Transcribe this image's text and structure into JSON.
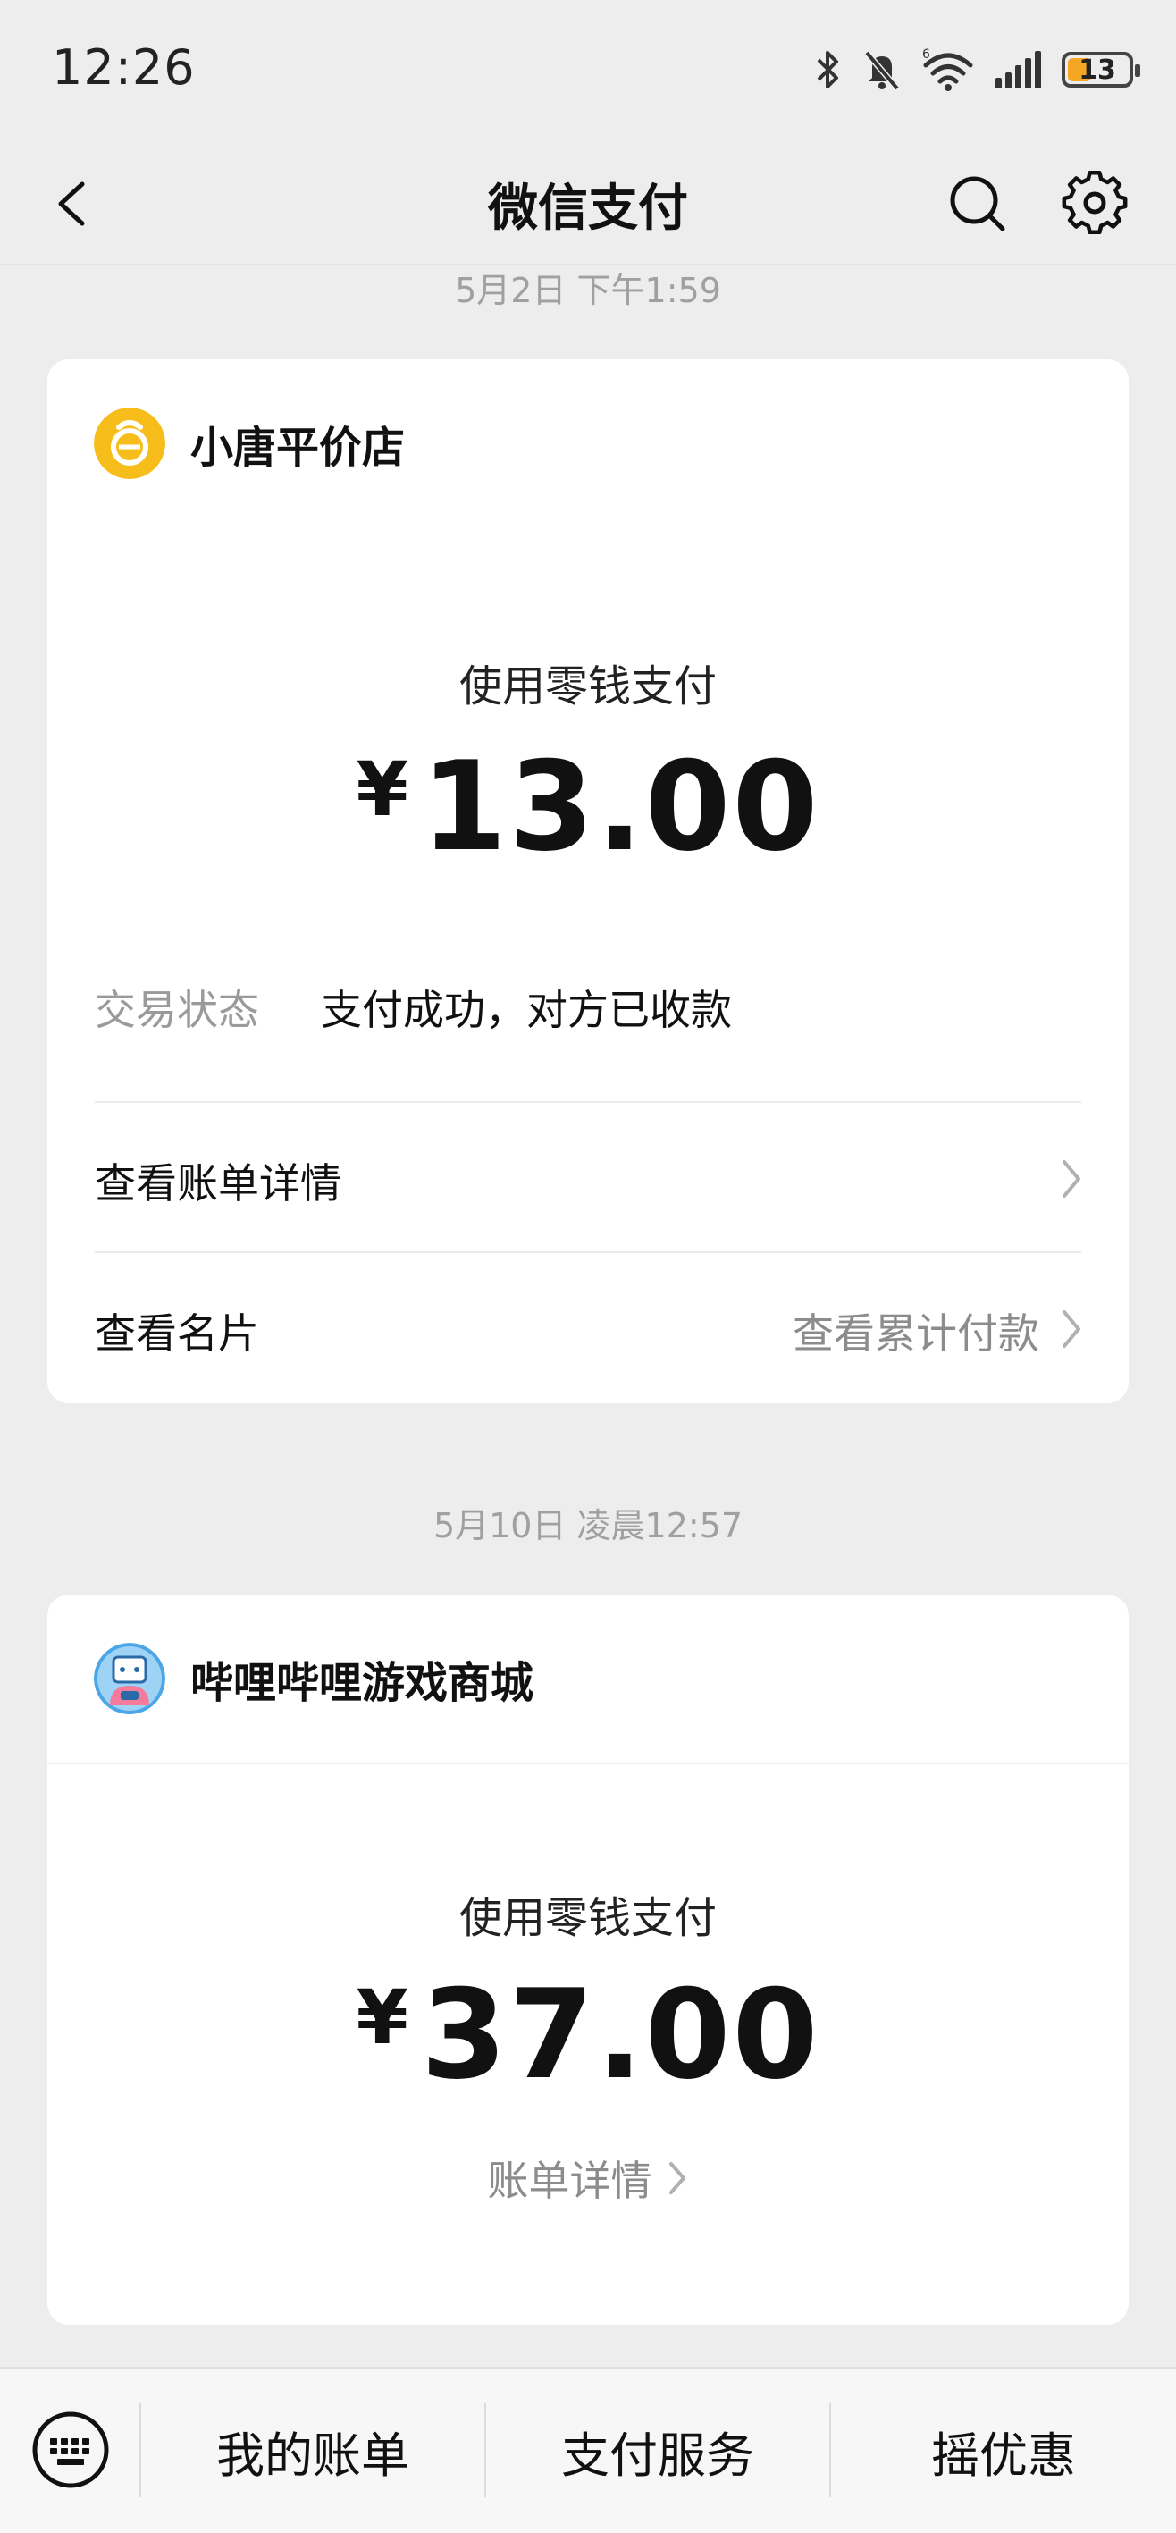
{
  "status_bar": {
    "time": "12:26",
    "battery": "13",
    "network_badge": "6"
  },
  "nav": {
    "title": "微信支付"
  },
  "transactions": [
    {
      "date": "5月2日 下午1:59",
      "merchant": "小唐平价店",
      "pay_method": "使用零钱支付",
      "currency": "¥",
      "amount": "13.00",
      "status_label": "交易状态",
      "status_value": "支付成功，对方已收款",
      "bill_detail": "查看账单详情",
      "card_label": "查看名片",
      "cumulative": "查看累计付款"
    },
    {
      "date": "5月10日 凌晨12:57",
      "merchant": "哔哩哔哩游戏商城",
      "pay_method": "使用零钱支付",
      "currency": "¥",
      "amount": "37.00",
      "bill_detail": "账单详情"
    }
  ],
  "tabbar": {
    "items": [
      "我的账单",
      "支付服务",
      "摇优惠"
    ]
  },
  "colors": {
    "background": "#ededed",
    "card": "#ffffff",
    "merchant_logo_yellow": "#f7be1b",
    "battery_fill": "#f5a623",
    "muted_text": "#9a9a9a"
  }
}
